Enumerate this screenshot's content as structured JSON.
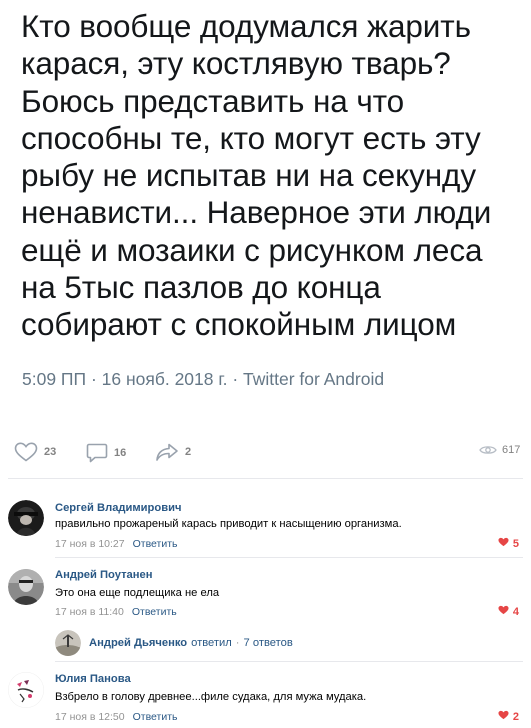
{
  "tweet": {
    "lines": [
      "Кто вообще додумался жарить",
      "карася, эту костлявую тварь?",
      "Боюсь представить на что",
      "способны те, кто могут есть эту",
      "рыбу не испытав ни на секунду",
      "ненависти... Наверное эти люди",
      "ещё и мозаики с рисунком леса",
      "на 5тыс пазлов до конца",
      "собирают с спокойным лицом"
    ],
    "meta": "5:09 ПП · 16 нояб. 2018 г. · Twitter for Android"
  },
  "actions": {
    "likes": "23",
    "comments": "16",
    "shares": "2",
    "views": "617"
  },
  "comments": [
    {
      "author": "Сергей Владимирович",
      "text": "правильно прожареный карась приводит к насыщению организма.",
      "time": "17 ноя в 10:27",
      "reply_label": "Ответить",
      "likes": "5"
    },
    {
      "author": "Андрей Поутанен",
      "text": "Это она еще подлещика не ела",
      "time": "17 ноя в 11:40",
      "reply_label": "Ответить",
      "likes": "4"
    },
    {
      "author": "Юлия Панова",
      "text": "Взбрело в голову древнее...филе судака, для мужа мудака.",
      "time": "17 ноя в 12:50",
      "reply_label": "Ответить",
      "likes": "2"
    }
  ],
  "thread": {
    "author": "Андрей Дьяченко",
    "verb": "ответил",
    "dot": "·",
    "count": "7 ответов"
  },
  "colors": {
    "link": "#2a5885",
    "meta": "#939393",
    "like_active": "#e64646",
    "tweet_text": "#14171a",
    "tweet_meta": "#657786"
  },
  "icons": {
    "like": "heart-icon",
    "comment": "speech-bubble-icon",
    "share": "share-arrow-icon",
    "views": "eye-icon"
  }
}
